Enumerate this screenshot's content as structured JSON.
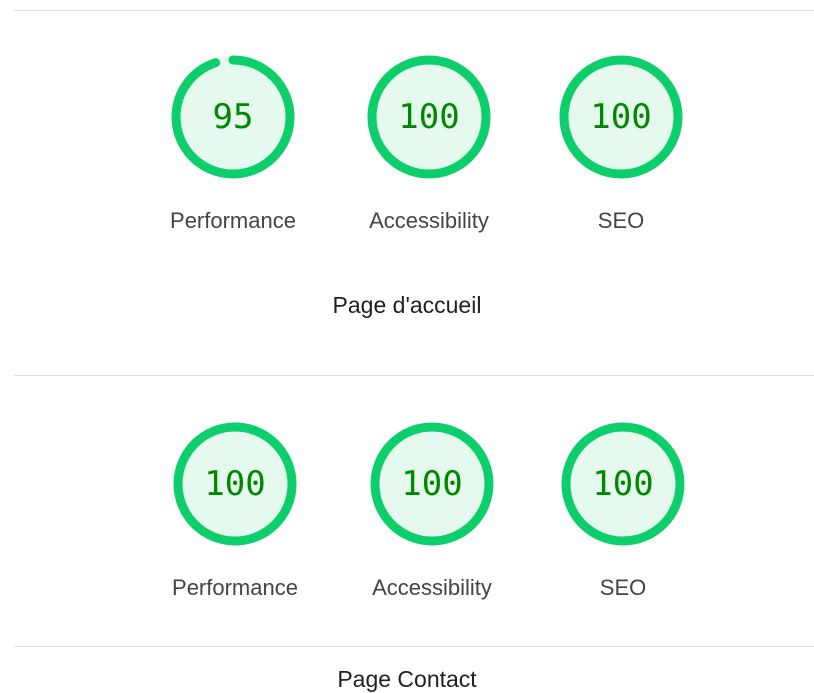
{
  "colors": {
    "pass_ring": "#0cce6b",
    "pass_fill": "#e6f9ee",
    "pass_text": "#008800",
    "track": "#e6f9ee"
  },
  "sections": [
    {
      "caption": "Page d'accueil",
      "gauges": [
        {
          "label": "Performance",
          "score": 95
        },
        {
          "label": "Accessibility",
          "score": 100
        },
        {
          "label": "SEO",
          "score": 100
        }
      ]
    },
    {
      "caption": "Page Contact",
      "gauges": [
        {
          "label": "Performance",
          "score": 100
        },
        {
          "label": "Accessibility",
          "score": 100
        },
        {
          "label": "SEO",
          "score": 100
        }
      ]
    }
  ]
}
